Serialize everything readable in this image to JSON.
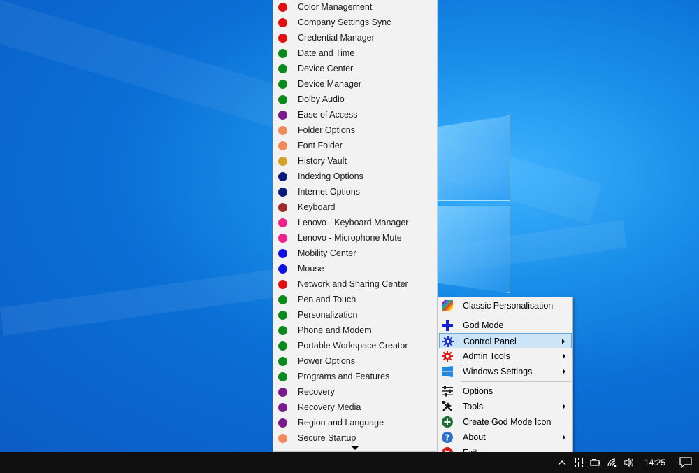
{
  "desktop": {
    "background": "#0b6fd6"
  },
  "submenu": {
    "items": [
      {
        "label": "Color Management",
        "color": "#e01010"
      },
      {
        "label": "Company Settings Sync",
        "color": "#e01010"
      },
      {
        "label": "Credential Manager",
        "color": "#e01010"
      },
      {
        "label": "Date and Time",
        "color": "#0a8a1e"
      },
      {
        "label": "Device Center",
        "color": "#0a8a1e"
      },
      {
        "label": "Device Manager",
        "color": "#0a8a1e"
      },
      {
        "label": "Dolby Audio",
        "color": "#0a8a1e"
      },
      {
        "label": "Ease of Access",
        "color": "#7b1a8c"
      },
      {
        "label": "Folder Options",
        "color": "#f08a5a"
      },
      {
        "label": "Font Folder",
        "color": "#f08a5a"
      },
      {
        "label": "History Vault",
        "color": "#d4a02a"
      },
      {
        "label": "Indexing Options",
        "color": "#0a1a78"
      },
      {
        "label": "Internet Options",
        "color": "#0a1a78"
      },
      {
        "label": "Keyboard",
        "color": "#a02a2a"
      },
      {
        "label": "Lenovo - Keyboard Manager",
        "color": "#f0208a"
      },
      {
        "label": "Lenovo - Microphone Mute",
        "color": "#f0208a"
      },
      {
        "label": "Mobility Center",
        "color": "#1010e0"
      },
      {
        "label": "Mouse",
        "color": "#1010e0"
      },
      {
        "label": "Network and Sharing Center",
        "color": "#e01010"
      },
      {
        "label": "Pen and Touch",
        "color": "#0a8a1e"
      },
      {
        "label": "Personalization",
        "color": "#0a8a1e"
      },
      {
        "label": "Phone and Modem",
        "color": "#0a8a1e"
      },
      {
        "label": "Portable Workspace Creator",
        "color": "#0a8a1e"
      },
      {
        "label": "Power Options",
        "color": "#0a8a1e"
      },
      {
        "label": "Programs and Features",
        "color": "#0a8a1e"
      },
      {
        "label": "Recovery",
        "color": "#7b1a8c"
      },
      {
        "label": "Recovery Media",
        "color": "#7b1a8c"
      },
      {
        "label": "Region and Language",
        "color": "#7b1a8c"
      },
      {
        "label": "Secure Startup",
        "color": "#f08a5a"
      }
    ]
  },
  "context_menu": {
    "items": [
      {
        "label": "Classic Personalisation",
        "icon": "palette-icon",
        "submenu": false
      },
      {
        "label": "God Mode",
        "icon": "plus-icon",
        "submenu": false
      },
      {
        "label": "Control Panel",
        "icon": "gear-blue-icon",
        "submenu": true,
        "highlighted": true
      },
      {
        "label": "Admin Tools",
        "icon": "gear-red-icon",
        "submenu": true
      },
      {
        "label": "Windows Settings",
        "icon": "windows-icon",
        "submenu": true
      },
      {
        "label": "Options",
        "icon": "sliders-icon",
        "submenu": false
      },
      {
        "label": "Tools",
        "icon": "tools-icon",
        "submenu": true
      },
      {
        "label": "Create God Mode Icon",
        "icon": "add-circle-icon",
        "submenu": false
      },
      {
        "label": "About",
        "icon": "help-icon",
        "submenu": true
      },
      {
        "label": "Exit",
        "icon": "close-circle-icon",
        "submenu": false
      }
    ]
  },
  "taskbar": {
    "time": "14:25"
  }
}
